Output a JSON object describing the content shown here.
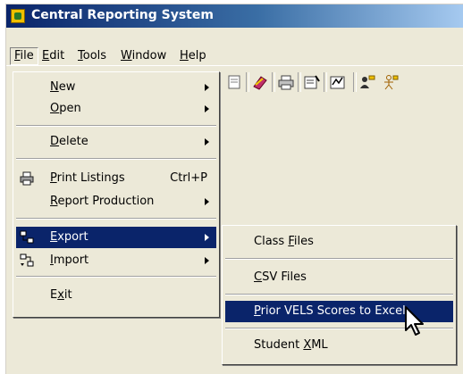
{
  "window": {
    "title": "Central Reporting System"
  },
  "menubar": {
    "items": [
      {
        "label": "File",
        "mnemonic": "F",
        "rest": "ile"
      },
      {
        "label": "Edit",
        "mnemonic": "E",
        "rest": "dit"
      },
      {
        "label": "Tools",
        "mnemonic": "T",
        "rest": "ools"
      },
      {
        "label": "Window",
        "mnemonic": "W",
        "rest": "indow"
      },
      {
        "label": "Help",
        "mnemonic": "H",
        "rest": "elp"
      }
    ]
  },
  "toolbar": {
    "icons": [
      "document-icon",
      "eraser-icon",
      "printer-icon",
      "report-icon",
      "preview-icon",
      "user-edit-icon",
      "person-icon"
    ]
  },
  "file_menu": {
    "items": [
      {
        "pre": "",
        "mn": "N",
        "post": "ew",
        "submenu": true
      },
      {
        "pre": "",
        "mn": "O",
        "post": "pen",
        "submenu": true
      },
      {
        "pre": "",
        "mn": "D",
        "post": "elete",
        "submenu": true
      },
      {
        "pre": "",
        "mn": "P",
        "post": "rint Listings",
        "shortcut": "Ctrl+P",
        "icon": "printer-icon"
      },
      {
        "pre": "",
        "mn": "R",
        "post": "eport Production",
        "submenu": true
      },
      {
        "pre": "",
        "mn": "E",
        "post": "xport",
        "submenu": true,
        "selected": true,
        "icon": "export-icon"
      },
      {
        "pre": "",
        "mn": "I",
        "post": "mport",
        "submenu": true,
        "icon": "import-icon"
      },
      {
        "pre": "E",
        "mn": "x",
        "post": "it"
      }
    ]
  },
  "export_menu": {
    "items": [
      {
        "pre": "Class ",
        "mn": "F",
        "post": "iles"
      },
      {
        "pre": "",
        "mn": "C",
        "post": "SV Files"
      },
      {
        "pre": "",
        "mn": "P",
        "post": "rior VELS Scores to Excel",
        "selected": true
      },
      {
        "pre": "Student ",
        "mn": "X",
        "post": "ML"
      }
    ]
  },
  "colors": {
    "selection": "#0a246a",
    "menu_bg": "#ece9d8",
    "title_start": "#0a246a"
  }
}
